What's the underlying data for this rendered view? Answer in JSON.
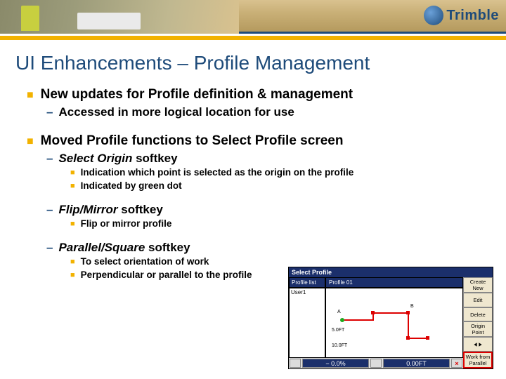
{
  "logo": {
    "text": "Trimble"
  },
  "title": "UI Enhancements – Profile Management",
  "bullets": [
    {
      "text": "New updates for Profile definition & management",
      "children": [
        {
          "text": "Accessed in more logical location for use"
        }
      ]
    },
    {
      "text_pre": "Moved Profile functions to ",
      "text_ital": "Select Profile",
      "text_post": " screen",
      "children": [
        {
          "text_ital": "Select Origin",
          "text_post": " softkey",
          "sub": [
            {
              "text": "Indication which point is selected as the origin on the profile"
            },
            {
              "text": "Indicated by green dot"
            }
          ]
        },
        {
          "text_ital": "Flip/Mirror",
          "text_post": " softkey",
          "sub": [
            {
              "text": "Flip or mirror profile"
            }
          ]
        },
        {
          "text_ital": "Parallel/Square",
          "text_post": " softkey",
          "sub": [
            {
              "text": "To select orientation of work"
            },
            {
              "text": "Perpendicular or parallel to the profile"
            }
          ]
        }
      ]
    }
  ],
  "screenshot": {
    "window_title": "Select Profile",
    "tab": "Profile list",
    "list_item": "User1",
    "mid_title": "Profile 01",
    "labels": {
      "a": "A",
      "b": "B",
      "dim1": "5.0FT",
      "dim2": "10.0FT"
    },
    "buttons": {
      "create": "Create New",
      "edit": "Edit",
      "delete": "Delete",
      "origin": "Origin Point",
      "flip": "",
      "parallel": "Work from Parallel"
    },
    "footer": {
      "left": "− 0.0%",
      "right": "0.00FT",
      "close": "×"
    }
  }
}
